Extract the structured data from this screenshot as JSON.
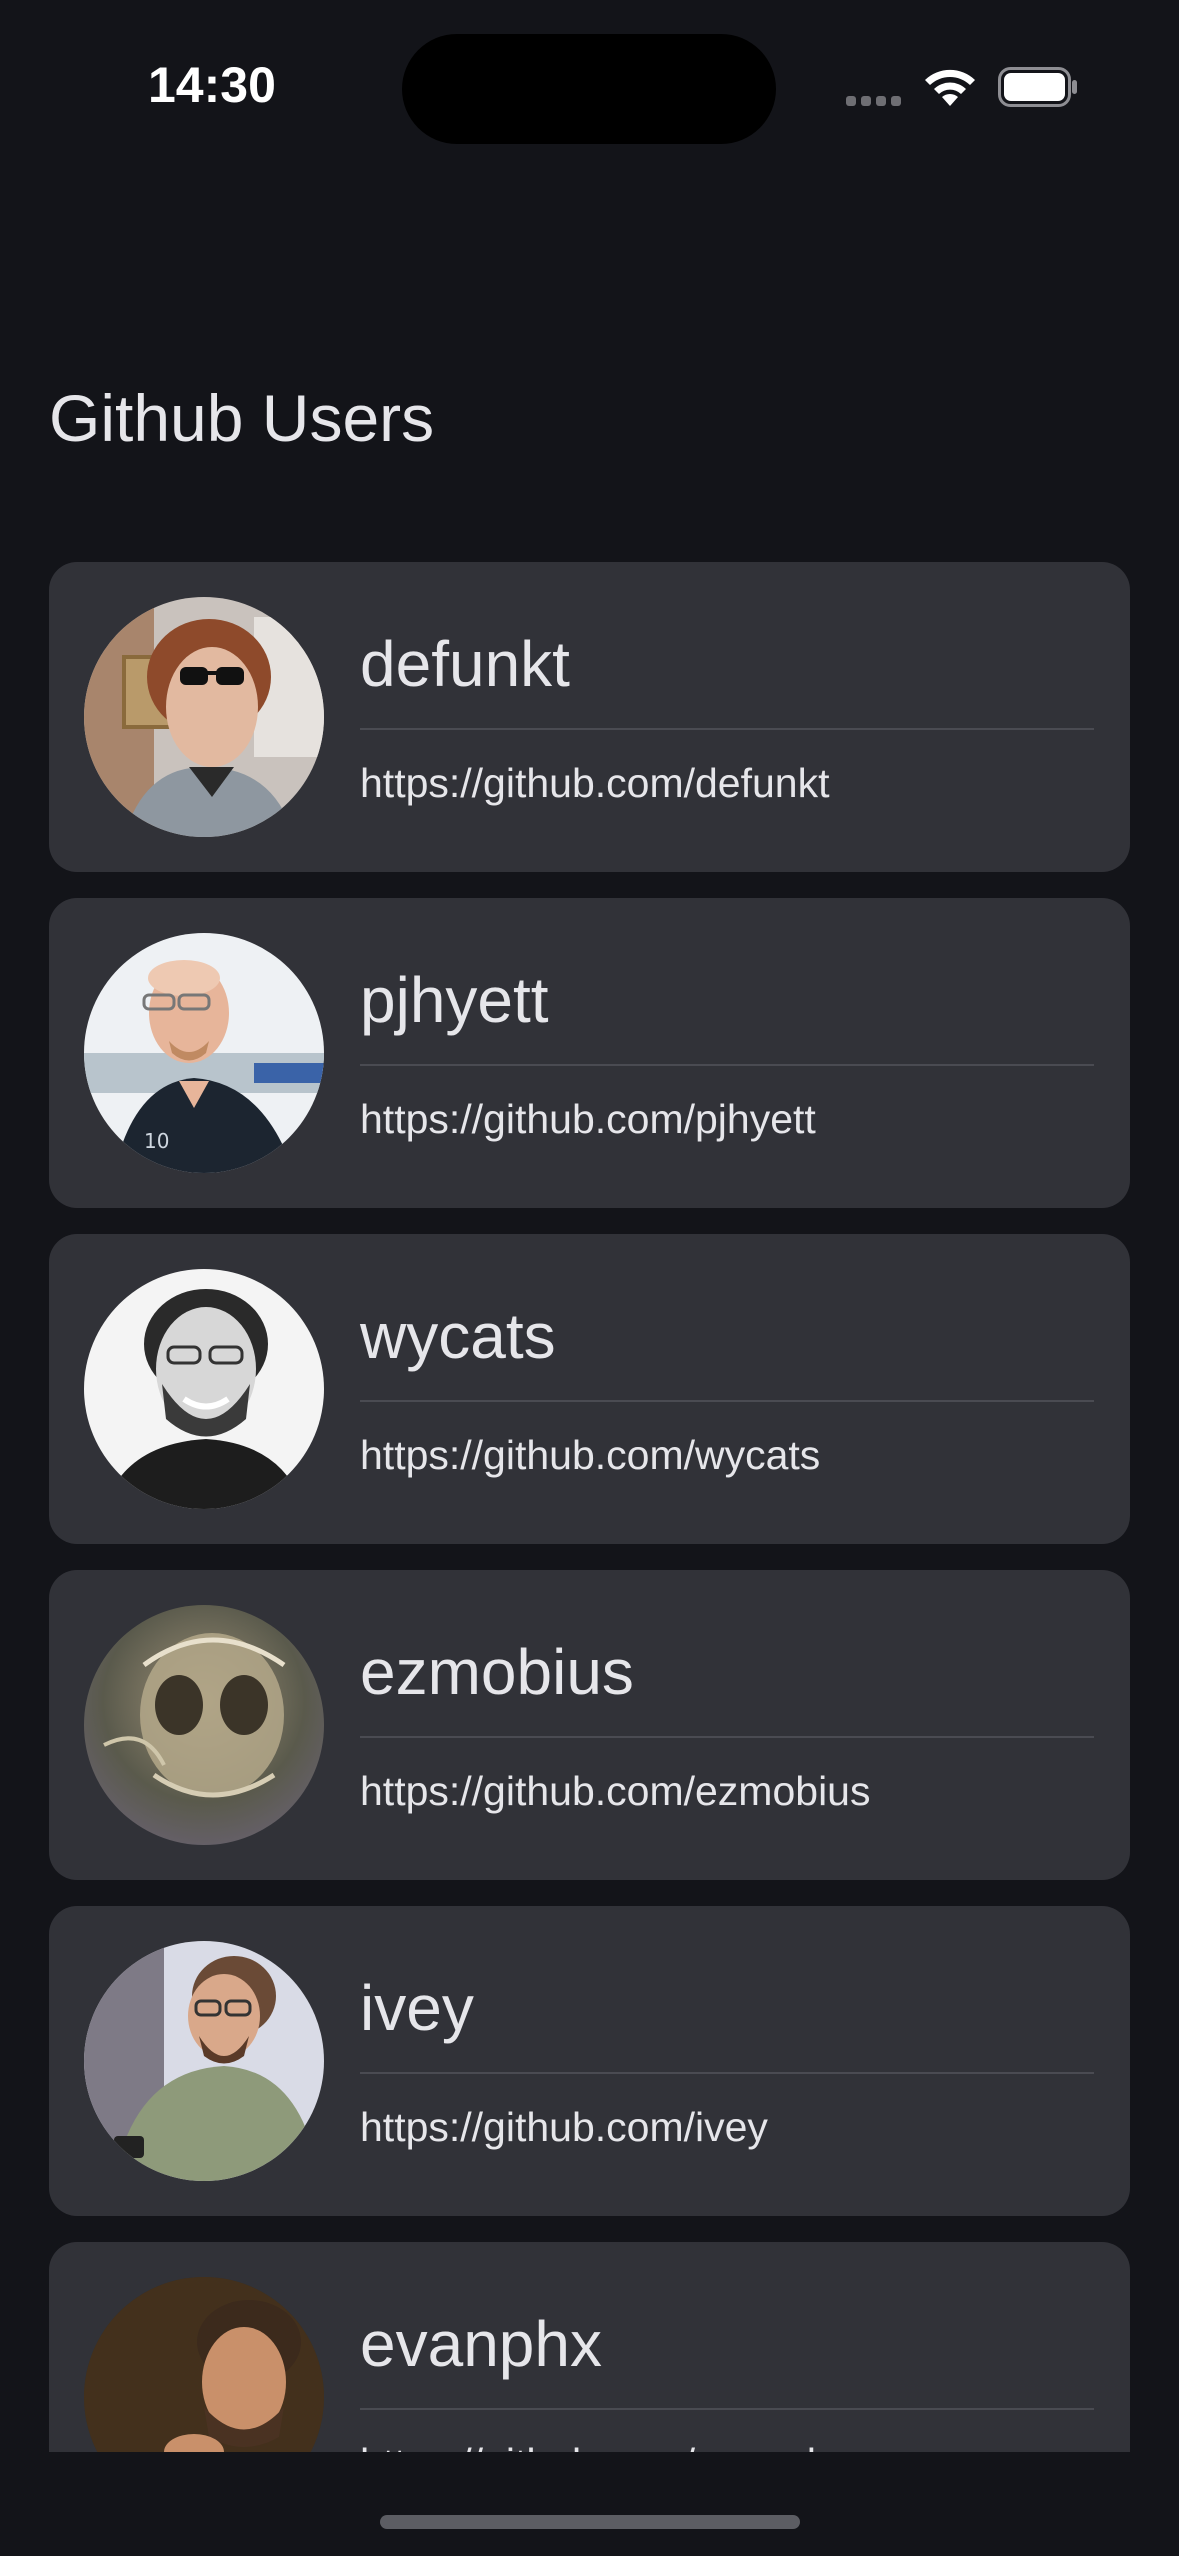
{
  "status_bar": {
    "time": "14:30",
    "icons": [
      "cellular-signal-icon",
      "wifi-icon",
      "battery-icon"
    ]
  },
  "header": {
    "title": "Github Users"
  },
  "users": [
    {
      "login": "defunkt",
      "url": "https://github.com/defunkt",
      "avatar": "avatar-photo-sunglasses"
    },
    {
      "login": "pjhyett",
      "url": "https://github.com/pjhyett",
      "avatar": "avatar-photo-glasses-bald"
    },
    {
      "login": "wycats",
      "url": "https://github.com/wycats",
      "avatar": "avatar-photo-bw-smiling"
    },
    {
      "login": "ezmobius",
      "url": "https://github.com/ezmobius",
      "avatar": "avatar-abstract-alien"
    },
    {
      "login": "ivey",
      "url": "https://github.com/ivey",
      "avatar": "avatar-photo-looking-down"
    },
    {
      "login": "evanphx",
      "url": "https://github.com/evanphx",
      "avatar": "avatar-photo-dark"
    }
  ],
  "colors": {
    "background": "#131419",
    "card": "#313238",
    "text": "#e6e6ea",
    "divider": "#4a4b52"
  }
}
